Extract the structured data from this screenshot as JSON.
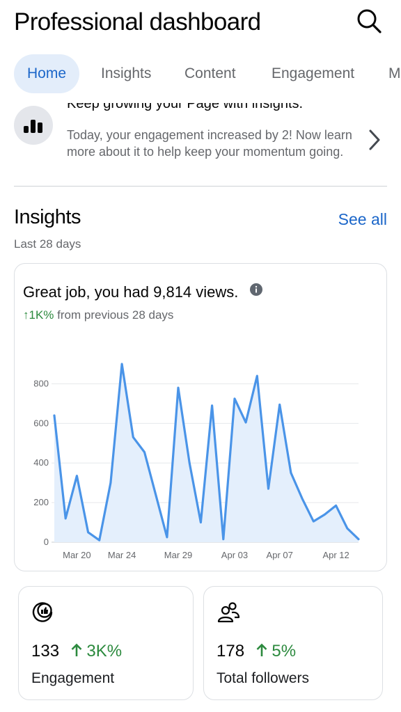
{
  "header": {
    "title": "Professional dashboard",
    "search_icon": "search-icon"
  },
  "tabs": [
    {
      "label": "Home",
      "active": true
    },
    {
      "label": "Insights",
      "active": false
    },
    {
      "label": "Content",
      "active": false
    },
    {
      "label": "Engagement",
      "active": false
    },
    {
      "label": "M",
      "active": false
    }
  ],
  "tip": {
    "icon": "bar-chart-icon",
    "title": "Keep growing your Page with insights.",
    "body": "Today, your engagement increased by 2! Now learn more about it to help keep your momentum going."
  },
  "insights": {
    "title": "Insights",
    "see_all": "See all",
    "period": "Last 28 days",
    "views_text": "Great job, you had 9,814 views.",
    "delta": "↑1K%",
    "delta_suffix": "from previous 28 days"
  },
  "chart_data": {
    "type": "area",
    "x": [
      "Mar 18",
      "Mar 19",
      "Mar 20",
      "Mar 21",
      "Mar 22",
      "Mar 23",
      "Mar 24",
      "Mar 25",
      "Mar 26",
      "Mar 27",
      "Mar 28",
      "Mar 29",
      "Mar 30",
      "Mar 31",
      "Apr 01",
      "Apr 02",
      "Apr 03",
      "Apr 04",
      "Apr 05",
      "Apr 06",
      "Apr 07",
      "Apr 08",
      "Apr 09",
      "Apr 10",
      "Apr 11",
      "Apr 12",
      "Apr 13",
      "Apr 14"
    ],
    "values": [
      640,
      120,
      335,
      50,
      10,
      300,
      900,
      530,
      455,
      240,
      25,
      780,
      400,
      100,
      690,
      15,
      725,
      605,
      840,
      270,
      695,
      350,
      220,
      105,
      140,
      185,
      70,
      15
    ],
    "x_ticks": [
      "Mar 20",
      "Mar 24",
      "Mar 29",
      "Apr 03",
      "Apr 07",
      "Apr 12"
    ],
    "y_ticks": [
      0,
      200,
      400,
      600,
      800
    ],
    "ylim": [
      0,
      900
    ],
    "grid": true,
    "line_color": "#4a94e8",
    "fill_color": "#e4effc"
  },
  "stats": [
    {
      "icon": "engagement-icon",
      "value": "133",
      "delta": "3K%",
      "label": "Engagement"
    },
    {
      "icon": "followers-icon",
      "value": "178",
      "delta": "5%",
      "label": "Total followers"
    }
  ],
  "colors": {
    "accent": "#1b66c9",
    "positive": "#2c8a3e",
    "muted": "#65676b"
  }
}
